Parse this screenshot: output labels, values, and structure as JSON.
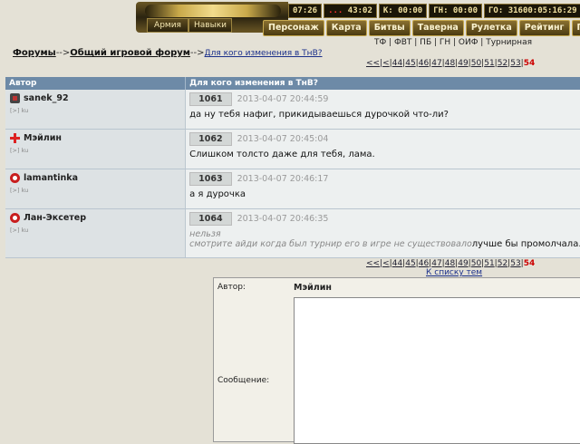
{
  "topbar": {
    "emblem_text": "",
    "buttons": [
      "Армия",
      "Навыки"
    ],
    "stats": [
      {
        "label": "07:26"
      },
      {
        "label_red": "...",
        "label": " 43:02"
      },
      {
        "label": "К: 00:00"
      },
      {
        "label": "ГН: 00:00"
      },
      {
        "label": "ГО: 31600:05:16:29"
      }
    ],
    "menu": [
      "Персонаж",
      "Карта",
      "Битвы",
      "Таверна",
      "Рулетка",
      "Рейтинг",
      "Гл"
    ]
  },
  "breadcrumb": {
    "forums": "Форумы",
    "sep1": "-->",
    "general": "Общий игровой форум",
    "sep2": "-->",
    "topic": "Для кого изменения в ТнВ?"
  },
  "sections": "ТФ | ФВТ | ПБ | ГН | ОИФ | Турнирная",
  "pager": {
    "first": "<<",
    "prev": "|<",
    "pages": [
      "44",
      "45",
      "46",
      "47",
      "48",
      "49",
      "50",
      "51",
      "52",
      "53"
    ],
    "current": "54"
  },
  "table": {
    "col_author": "Автор",
    "col_topic": "Для кого изменения в ТнВ?",
    "posts": [
      {
        "author": "sanek_92",
        "icon": "bat-clan-icon",
        "num": "1061",
        "date": "2013-04-07 20:44:59",
        "text": "да ну тебя нафиг, прикидываешься дурочкой что-ли?",
        "sub": "[>] ku"
      },
      {
        "author": "Мэйлин",
        "icon": "red-cross-icon",
        "num": "1062",
        "date": "2013-04-07 20:45:04",
        "text": "Слишком толсто даже для тебя, лама.",
        "sub": "[>] ku"
      },
      {
        "author": "lamantinka",
        "icon": "red-ring-icon",
        "num": "1063",
        "date": "2013-04-07 20:46:17",
        "text": "а я дурочка",
        "sub": "[>] ku"
      },
      {
        "author": "Лан-Эксетер",
        "icon": "red-ring-icon",
        "num": "1064",
        "date": "2013-04-07 20:46:35",
        "quote1": "нельзя",
        "quote2": "смотрите айди когда был турнир его в игре не существовало",
        "text": "лучше бы промолчала.",
        "sub": "[>] ku"
      }
    ]
  },
  "back_link": "К списку тем",
  "reply": {
    "author_label": "Автор:",
    "author_value": "Мэйлин",
    "message_label": "Сообщение:",
    "message_value": ""
  }
}
